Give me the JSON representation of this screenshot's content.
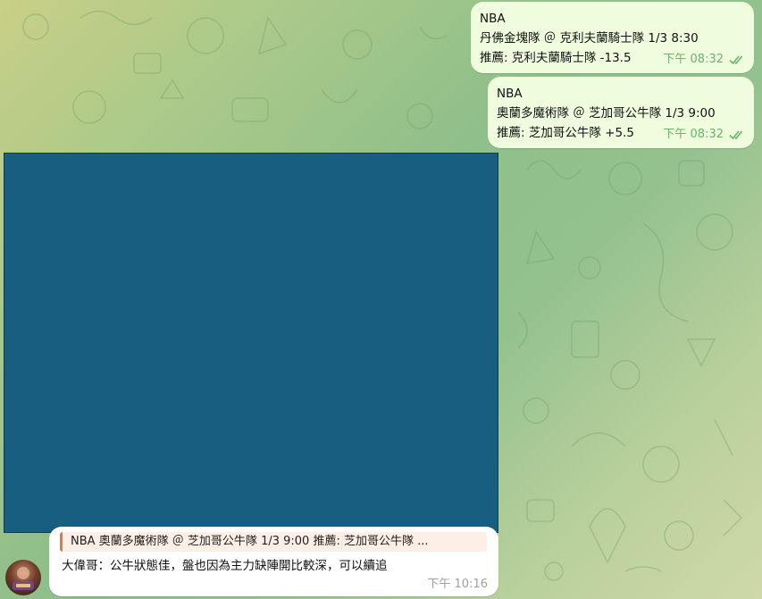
{
  "messages": [
    {
      "line1": "NBA",
      "line2": "丹佛金塊隊 ＠ 克利夫蘭騎士隊 1/3 8:30",
      "line3": "推薦: 克利夫蘭騎士隊 -13.5",
      "time": "下午 08:32"
    },
    {
      "line1": "NBA",
      "line2": "奧蘭多魔術隊 ＠ 芝加哥公牛隊 1/3 9:00",
      "line3": "推薦: 芝加哥公牛隊 +5.5",
      "time": "下午 08:32"
    }
  ],
  "reply": {
    "quote": "NBA 奧蘭多魔術隊 ＠ 芝加哥公牛隊 1/3 9:00 推薦: 芝加哥公牛隊 ...",
    "text": "大偉哥：公牛狀態佳，盤也因為主力缺陣開比較深，可以續追",
    "time": "下午 10:16"
  },
  "colors": {
    "outgoing_bubble": "#effdde",
    "time_green": "#6bb26b",
    "media_block": "#175e80",
    "quote_accent": "#e07a45"
  },
  "icons": {
    "read_receipt": "double-check-icon"
  }
}
